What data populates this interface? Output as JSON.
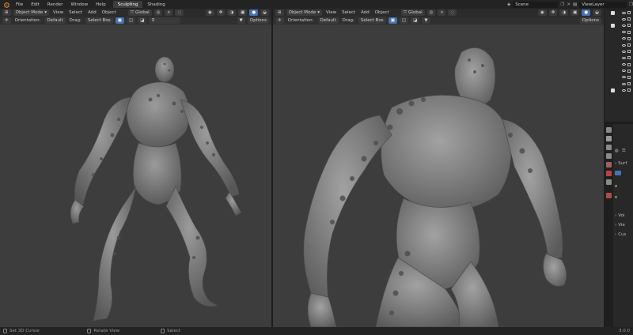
{
  "menu": [
    "File",
    "Edit",
    "Render",
    "Window",
    "Help"
  ],
  "workspace_tabs": [
    {
      "label": "Sculpting",
      "active": true
    },
    {
      "label": "Shading",
      "active": false
    }
  ],
  "scene": {
    "label": "Scene"
  },
  "view_layer": {
    "label": "ViewLayer"
  },
  "viewports": [
    {
      "mode": "Object Mode",
      "menus": [
        "View",
        "Select",
        "Add",
        "Object"
      ],
      "transform": "Global",
      "orientation_label": "Orientation:",
      "orientation_value": "Default",
      "drag_label": "Drag:",
      "drag_value": "Select Box",
      "options": "Options"
    },
    {
      "mode": "Object Mode",
      "menus": [
        "View",
        "Select",
        "Add",
        "Object"
      ],
      "transform": "Global",
      "orientation_label": "Orientation:",
      "orientation_value": "Default",
      "drag_label": "Drag:",
      "drag_value": "Select Box",
      "options": "Options"
    }
  ],
  "properties_labels": [
    "Surf",
    "Vol",
    "Vie",
    "Cus"
  ],
  "status": [
    "Set 3D Cursor",
    "Rotate View",
    "Select"
  ],
  "version": "3.0.0",
  "colors": {
    "accent": "#4772b3",
    "viewport_bg": "#3d3d3d",
    "header_bg": "#2b2b2b"
  }
}
